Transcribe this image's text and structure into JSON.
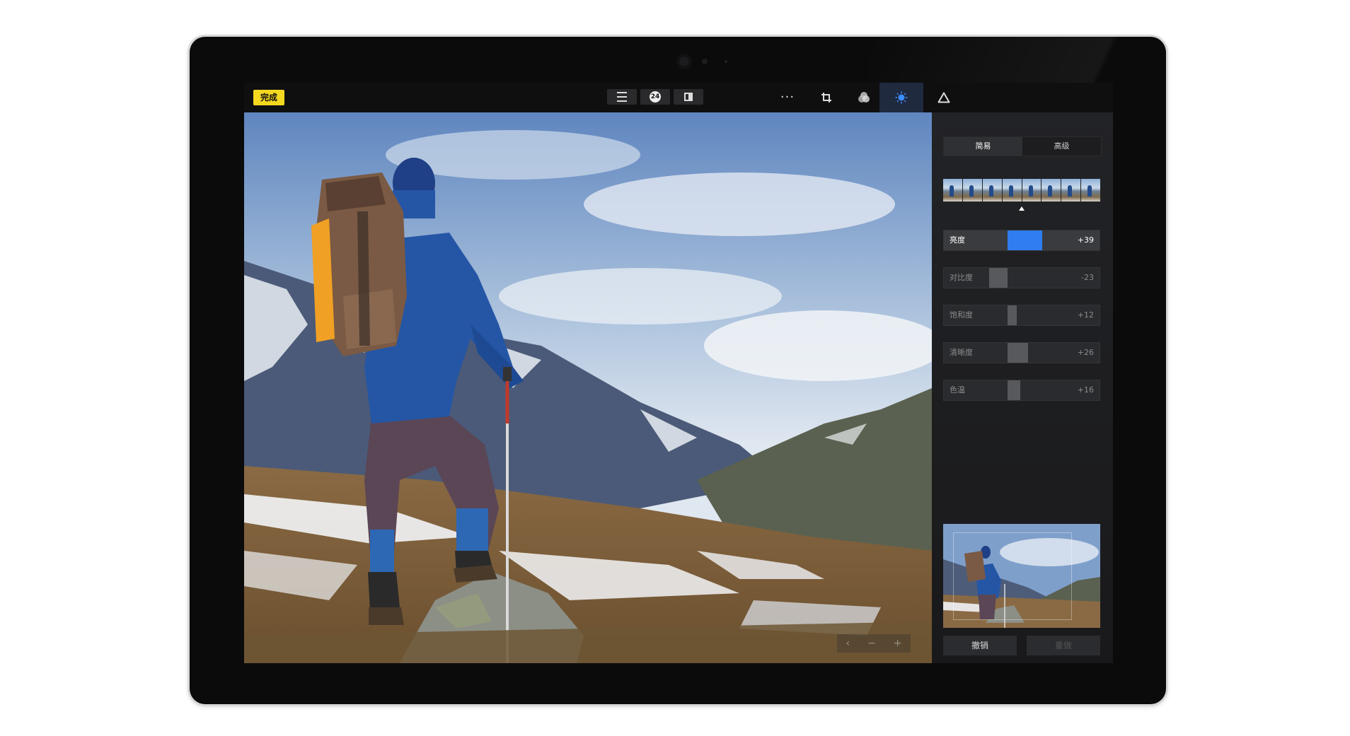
{
  "topbar": {
    "done_label": "完成",
    "menu_icon": "menu-icon",
    "badge_count": "24",
    "compare_icon": "split-view-icon",
    "more_icon": "more-dots-icon",
    "tools": [
      "crop-icon",
      "filters-icon",
      "light-adjust-icon",
      "triangle-icon"
    ],
    "active_tool": "light-adjust-icon"
  },
  "panel": {
    "tabs": [
      {
        "label": "简易",
        "active": true
      },
      {
        "label": "高级",
        "active": false
      }
    ],
    "sliders": [
      {
        "label": "亮度",
        "value": "+39",
        "active": true
      },
      {
        "label": "对比度",
        "value": "-23",
        "active": false
      },
      {
        "label": "饱和度",
        "value": "+12",
        "active": false
      },
      {
        "label": "清晰度",
        "value": "+26",
        "active": false
      },
      {
        "label": "色温",
        "value": "+16",
        "active": false
      }
    ],
    "undo_label": "撤销",
    "redo_label": "重做"
  },
  "zoom_controls": {
    "prev": "‹",
    "minus": "−",
    "plus": "+"
  },
  "colors": {
    "accent_yellow": "#f4d81f",
    "accent_blue": "#2f7df0"
  }
}
